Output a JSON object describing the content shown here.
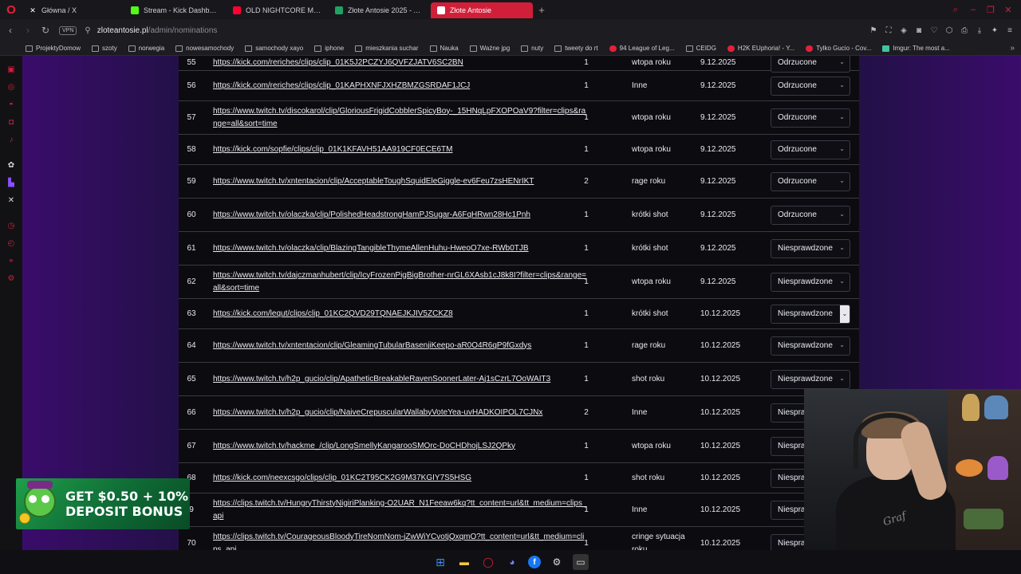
{
  "browser": {
    "tabs": [
      {
        "label": "Główna / X",
        "icon": "x-icon",
        "color": "#ffffff"
      },
      {
        "label": "Stream - Kick Dashboard",
        "icon": "kick-icon",
        "color": "#53fc18"
      },
      {
        "label": "OLD NIGHTCORE MIX *20",
        "icon": "youtube-icon",
        "color": "#ff0033"
      },
      {
        "label": "Złote Antosie 2025 - Arku",
        "icon": "sheets-icon",
        "color": "#1ea362"
      },
      {
        "label": "Złote Antosie",
        "icon": "site-icon",
        "color": "#ffffff",
        "active": true
      }
    ],
    "new_tab": "+",
    "address": {
      "vpn": "VPN",
      "host": "zloteantosie.pl",
      "path": "/admin/nominations"
    },
    "bookmarks": [
      {
        "label": "ProjektyDomow",
        "icon": "folder"
      },
      {
        "label": "szoty",
        "icon": "folder"
      },
      {
        "label": "norwegia",
        "icon": "folder"
      },
      {
        "label": "nowesamochody",
        "icon": "folder"
      },
      {
        "label": "samochody xayo",
        "icon": "folder"
      },
      {
        "label": "iphone",
        "icon": "folder"
      },
      {
        "label": "mieszkania suchar",
        "icon": "folder"
      },
      {
        "label": "Nauka",
        "icon": "folder"
      },
      {
        "label": "Ważne jpg",
        "icon": "folder"
      },
      {
        "label": "nuty",
        "icon": "folder"
      },
      {
        "label": "tweety do rt",
        "icon": "folder"
      },
      {
        "label": "94 League of Leg...",
        "icon": "red"
      },
      {
        "label": "CEIDG",
        "icon": "folder"
      },
      {
        "label": "H2K EUphoria! - Y...",
        "icon": "red"
      },
      {
        "label": "Tylko Gucio - Cov...",
        "icon": "red"
      },
      {
        "label": "Imgur: The most a...",
        "icon": "teal"
      }
    ]
  },
  "nominations": [
    {
      "id": "55",
      "url": "https://kick.com/reriches/clips/clip_01K5J2PCZYJ6QVFZJATV6SC2BN",
      "votes": "1",
      "category": "wtopa roku",
      "date": "9.12.2025",
      "status": "Odrzucone"
    },
    {
      "id": "56",
      "url": "https://kick.com/reriches/clips/clip_01KAPHXNFJXHZBMZGSRDAF1JCJ",
      "votes": "1",
      "category": "Inne",
      "date": "9.12.2025",
      "status": "Odrzucone"
    },
    {
      "id": "57",
      "url": "https://www.twitch.tv/discokarol/clip/GloriousFrigidCobblerSpicyBoy-_15HNqLpFXOPOaV9?filter=clips&range=all&sort=time",
      "votes": "1",
      "category": "wtopa roku",
      "date": "9.12.2025",
      "status": "Odrzucone"
    },
    {
      "id": "58",
      "url": "https://kick.com/sopfie/clips/clip_01K1KFAVH51AA919CF0ECE6TM",
      "votes": "1",
      "category": "wtopa roku",
      "date": "9.12.2025",
      "status": "Odrzucone"
    },
    {
      "id": "59",
      "url": "https://www.twitch.tv/xntentacion/clip/AcceptableToughSquidEleGiggle-ev6Feu7zsHENrIKT",
      "votes": "2",
      "category": "rage roku",
      "date": "9.12.2025",
      "status": "Odrzucone"
    },
    {
      "id": "60",
      "url": "https://www.twitch.tv/olaczka/clip/PolishedHeadstrongHamPJSugar-A6FqHRwn28Hc1Pnh",
      "votes": "1",
      "category": "krótki shot",
      "date": "9.12.2025",
      "status": "Odrzucone"
    },
    {
      "id": "61",
      "url": "https://www.twitch.tv/olaczka/clip/BlazingTangibleThymeAllenHuhu-HweoO7xe-RWb0TJB",
      "votes": "1",
      "category": "krótki shot",
      "date": "9.12.2025",
      "status": "Niesprawdzone"
    },
    {
      "id": "62",
      "url": "https://www.twitch.tv/dajczmanhubert/clip/IcyFrozenPigBigBrother-nrGL6XAsb1cJ8k8I?filter=clips&range=all&sort=time",
      "votes": "1",
      "category": "wtopa roku",
      "date": "9.12.2025",
      "status": "Niesprawdzone"
    },
    {
      "id": "63",
      "url": "https://kick.com/lequt/clips/clip_01KC2QVD29TQNAEJKJIV5ZCKZ8",
      "votes": "1",
      "category": "krótki shot",
      "date": "10.12.2025",
      "status": "Niesprawdzone"
    },
    {
      "id": "64",
      "url": "https://www.twitch.tv/xntentacion/clip/GleamingTubularBasenjiKeepo-aR0O4R6qP9fGxdys",
      "votes": "1",
      "category": "rage roku",
      "date": "10.12.2025",
      "status": "Niesprawdzone"
    },
    {
      "id": "65",
      "url": "https://www.twitch.tv/h2p_gucio/clip/ApatheticBreakableRavenSoonerLater-Aj1sCzrL7OoWAIT3",
      "votes": "1",
      "category": "shot roku",
      "date": "10.12.2025",
      "status": "Niesprawdzone"
    },
    {
      "id": "66",
      "url": "https://www.twitch.tv/h2p_gucio/clip/NaiveCrepuscularWallabyVoteYea-uvHADKOIPOL7CJNx",
      "votes": "2",
      "category": "Inne",
      "date": "10.12.2025",
      "status": "Niespra"
    },
    {
      "id": "67",
      "url": "https://www.twitch.tv/hackme_/clip/LongSmellyKangarooSMOrc-DoCHDhojLSJ2QPky",
      "votes": "1",
      "category": "wtopa roku",
      "date": "10.12.2025",
      "status": "Niespra"
    },
    {
      "id": "68",
      "url": "https://kick.com/neexcsgo/clips/clip_01KC2T95CK2G9M37KGIY7S5HSG",
      "votes": "1",
      "category": "shot roku",
      "date": "10.12.2025",
      "status": "Niespra"
    },
    {
      "id": "9",
      "url": "https://clips.twitch.tv/HungryThirstyNigiriPlanking-O2UAR_N1Feeaw6kq?tt_content=url&tt_medium=clips_api",
      "votes": "1",
      "category": "Inne",
      "date": "10.12.2025",
      "status": "Niespra"
    },
    {
      "id": "70",
      "url": "https://clips.twitch.tv/CourageousBloodyTireNomNom-jZwWiYCvotjQxqmO?tt_content=url&tt_medium=clips_api",
      "votes": "1",
      "category": "cringe sytuacja roku",
      "date": "10.12.2025",
      "status": "Niespra"
    }
  ],
  "ad": {
    "line1": "GET $0.50 + 10%",
    "line2": "DEPOSIT BONUS"
  },
  "webcam": {
    "shirt_text": "Graf"
  },
  "colors": {
    "accent": "#d11f3a",
    "page_bg": "#120a27",
    "table_bg": "#0b0b10"
  }
}
